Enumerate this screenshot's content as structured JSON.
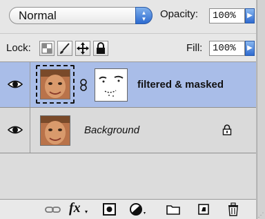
{
  "blend_mode": {
    "value": "Normal"
  },
  "opacity": {
    "label": "Opacity:",
    "value": "100%"
  },
  "lock": {
    "label": "Lock:"
  },
  "fill": {
    "label": "Fill:",
    "value": "100%"
  },
  "layers": [
    {
      "name": "filtered & masked",
      "selected": true,
      "visible": true,
      "has_mask": true,
      "locked": false
    },
    {
      "name": "Background",
      "selected": false,
      "visible": true,
      "has_mask": false,
      "locked": true
    }
  ],
  "colors": {
    "selected_row": "#a9bde8",
    "accent_blue": "#2c6ad0",
    "panel_bg": "#e6e6e6"
  },
  "bottom_icons": [
    "link-layers-icon",
    "fx-icon",
    "add-mask-icon",
    "adjustment-layer-icon",
    "new-group-icon",
    "new-layer-icon",
    "trash-icon"
  ],
  "bottom_bar": {
    "fx_label": "fx"
  }
}
